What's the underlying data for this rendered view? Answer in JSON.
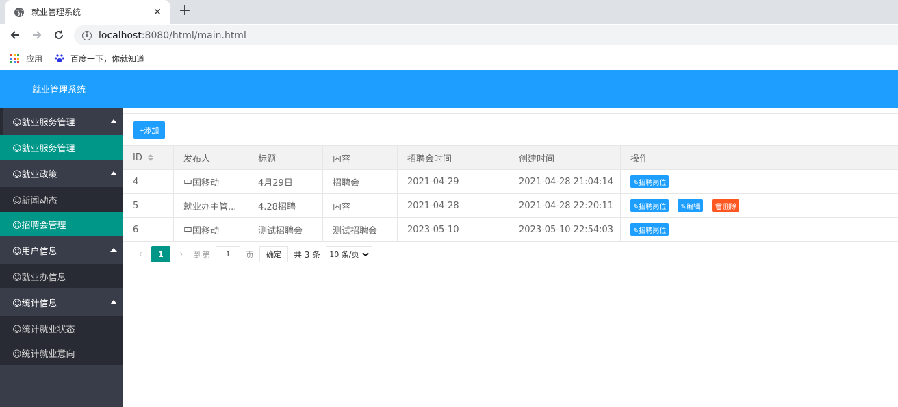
{
  "browser": {
    "tab_title": "就业管理系统",
    "url_host": "localhost",
    "url_rest": ":8080/html/main.html",
    "bookmarks": [
      "应用",
      "百度一下，你就知道"
    ]
  },
  "app": {
    "title": "就业管理系统"
  },
  "sidebar": {
    "items": [
      {
        "label": "☺就业服务管理",
        "type": "group"
      },
      {
        "label": "☺就业服务管理",
        "type": "sub",
        "active": true
      },
      {
        "label": "☺就业政策",
        "type": "group"
      },
      {
        "label": "☺新闻动态",
        "type": "sub"
      },
      {
        "label": "☺招聘会管理",
        "type": "sub",
        "active": true
      },
      {
        "label": "☺用户信息",
        "type": "group"
      },
      {
        "label": "☺就业办信息",
        "type": "sub"
      },
      {
        "label": "☺统计信息",
        "type": "group"
      },
      {
        "label": "☺统计就业状态",
        "type": "sub"
      },
      {
        "label": "☺统计就业意向",
        "type": "sub"
      }
    ]
  },
  "toolbar": {
    "add_label": "+添加"
  },
  "table": {
    "headers": [
      "ID",
      "发布人",
      "标题",
      "内容",
      "招聘会时间",
      "创建时间",
      "操作"
    ],
    "rows": [
      {
        "id": "4",
        "publisher": "中国移动",
        "title": "4月29日",
        "content": "招聘会",
        "fair_time": "2021-04-29",
        "created": "2021-04-28 21:04:14"
      },
      {
        "id": "5",
        "publisher": "就业办主管...",
        "title": "4.28招聘",
        "content": "内容",
        "fair_time": "2021-04-28",
        "created": "2021-04-28 22:20:11"
      },
      {
        "id": "6",
        "publisher": "中国移动",
        "title": "测试招聘会",
        "content": "测试招聘会",
        "fair_time": "2023-05-10",
        "created": "2023-05-10 22:54:03"
      }
    ],
    "actions": {
      "positions": "✎招聘岗位",
      "edit": "✎编辑",
      "delete": "🗑删除"
    }
  },
  "pager": {
    "current": "1",
    "goto_label": "到第",
    "page_input": "1",
    "page_unit": "页",
    "confirm": "确定",
    "total": "共 3 条",
    "page_size": "10 条/页"
  },
  "colors": {
    "header": "#1e9fff",
    "sidebar": "#393d49",
    "active": "#009688",
    "danger": "#ff5722"
  }
}
